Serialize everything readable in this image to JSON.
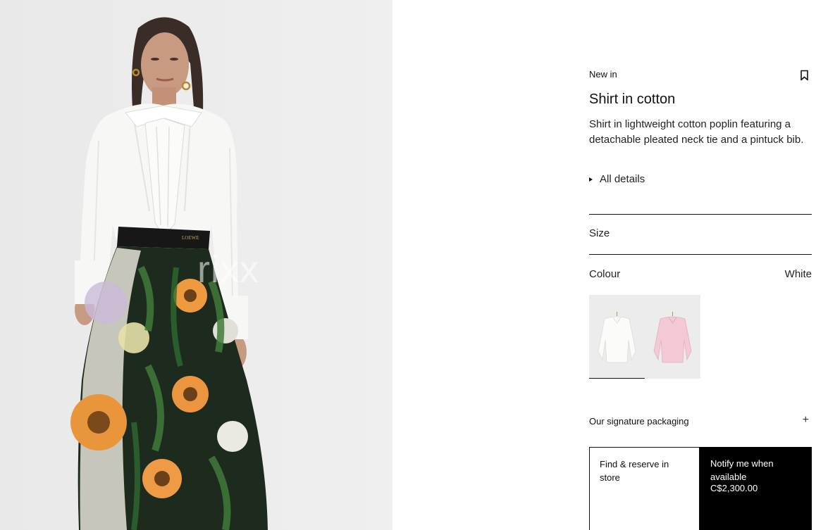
{
  "hero": {
    "watermark": "rixx"
  },
  "product": {
    "tag": "New in",
    "title": "Shirt in cotton",
    "description": "Shirt in lightweight cotton poplin featuring a detachable pleated neck tie and a pintuck bib.",
    "details_label": "All details",
    "size_label": "Size",
    "colour_label": "Colour",
    "colour_value": "White",
    "colours": [
      {
        "name": "White",
        "color": "#f4f4f2",
        "selected": true
      },
      {
        "name": "Pink",
        "color": "#f2c9d4",
        "selected": false
      }
    ],
    "packaging_label": "Our signature packaging",
    "find_store_label": "Find & reserve in store",
    "notify_label": "Notify me when available",
    "price": "C$2,300.00"
  },
  "icons": {
    "bookmark": "bookmark-icon",
    "expand": "plus-icon",
    "details_toggle": "triangle-right-icon"
  },
  "colors": {
    "accent": "#000000",
    "background": "#ffffff",
    "image_bg": "#ececec"
  }
}
